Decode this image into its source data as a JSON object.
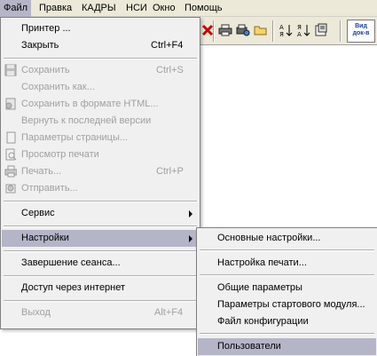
{
  "menubar": {
    "items": [
      {
        "label": "Файл"
      },
      {
        "label": "Правка"
      },
      {
        "label": "КАДРЫ"
      },
      {
        "label": "НСИ"
      },
      {
        "label": "Окно"
      },
      {
        "label": "Помощь"
      }
    ]
  },
  "toolbar": {
    "view_button": {
      "line1": "Вид",
      "line2": "док-в"
    }
  },
  "file_menu": {
    "items": [
      {
        "label": "Принтер ...",
        "shortcut": ""
      },
      {
        "label": "Закрыть",
        "shortcut": "Ctrl+F4"
      },
      {
        "label": "Сохранить",
        "shortcut": "Ctrl+S"
      },
      {
        "label": "Сохранить как...",
        "shortcut": ""
      },
      {
        "label": "Сохранить в формате HTML...",
        "shortcut": ""
      },
      {
        "label": "Вернуть к последней версии",
        "shortcut": ""
      },
      {
        "label": "Параметры страницы...",
        "shortcut": ""
      },
      {
        "label": "Просмотр печати",
        "shortcut": ""
      },
      {
        "label": "Печать...",
        "shortcut": "Ctrl+P"
      },
      {
        "label": "Отправить...",
        "shortcut": ""
      },
      {
        "label": "Сервис",
        "shortcut": ""
      },
      {
        "label": "Настройки",
        "shortcut": ""
      },
      {
        "label": "Завершение сеанса...",
        "shortcut": ""
      },
      {
        "label": "Доступ через интернет",
        "shortcut": ""
      },
      {
        "label": "Выход",
        "shortcut": "Alt+F4"
      }
    ]
  },
  "settings_submenu": {
    "items": [
      {
        "label": "Основные настройки..."
      },
      {
        "label": "Настройка печати..."
      },
      {
        "label": "Общие параметры"
      },
      {
        "label": "Параметры стартового модуля..."
      },
      {
        "label": "Файл конфигурации"
      },
      {
        "label": "Пользователи"
      }
    ]
  },
  "colors": {
    "menu_bg": "#f0f0f0",
    "highlight": "#b5b5c8",
    "bar_bg": "#ece9d8",
    "disabled_text": "#a0a0a0"
  }
}
